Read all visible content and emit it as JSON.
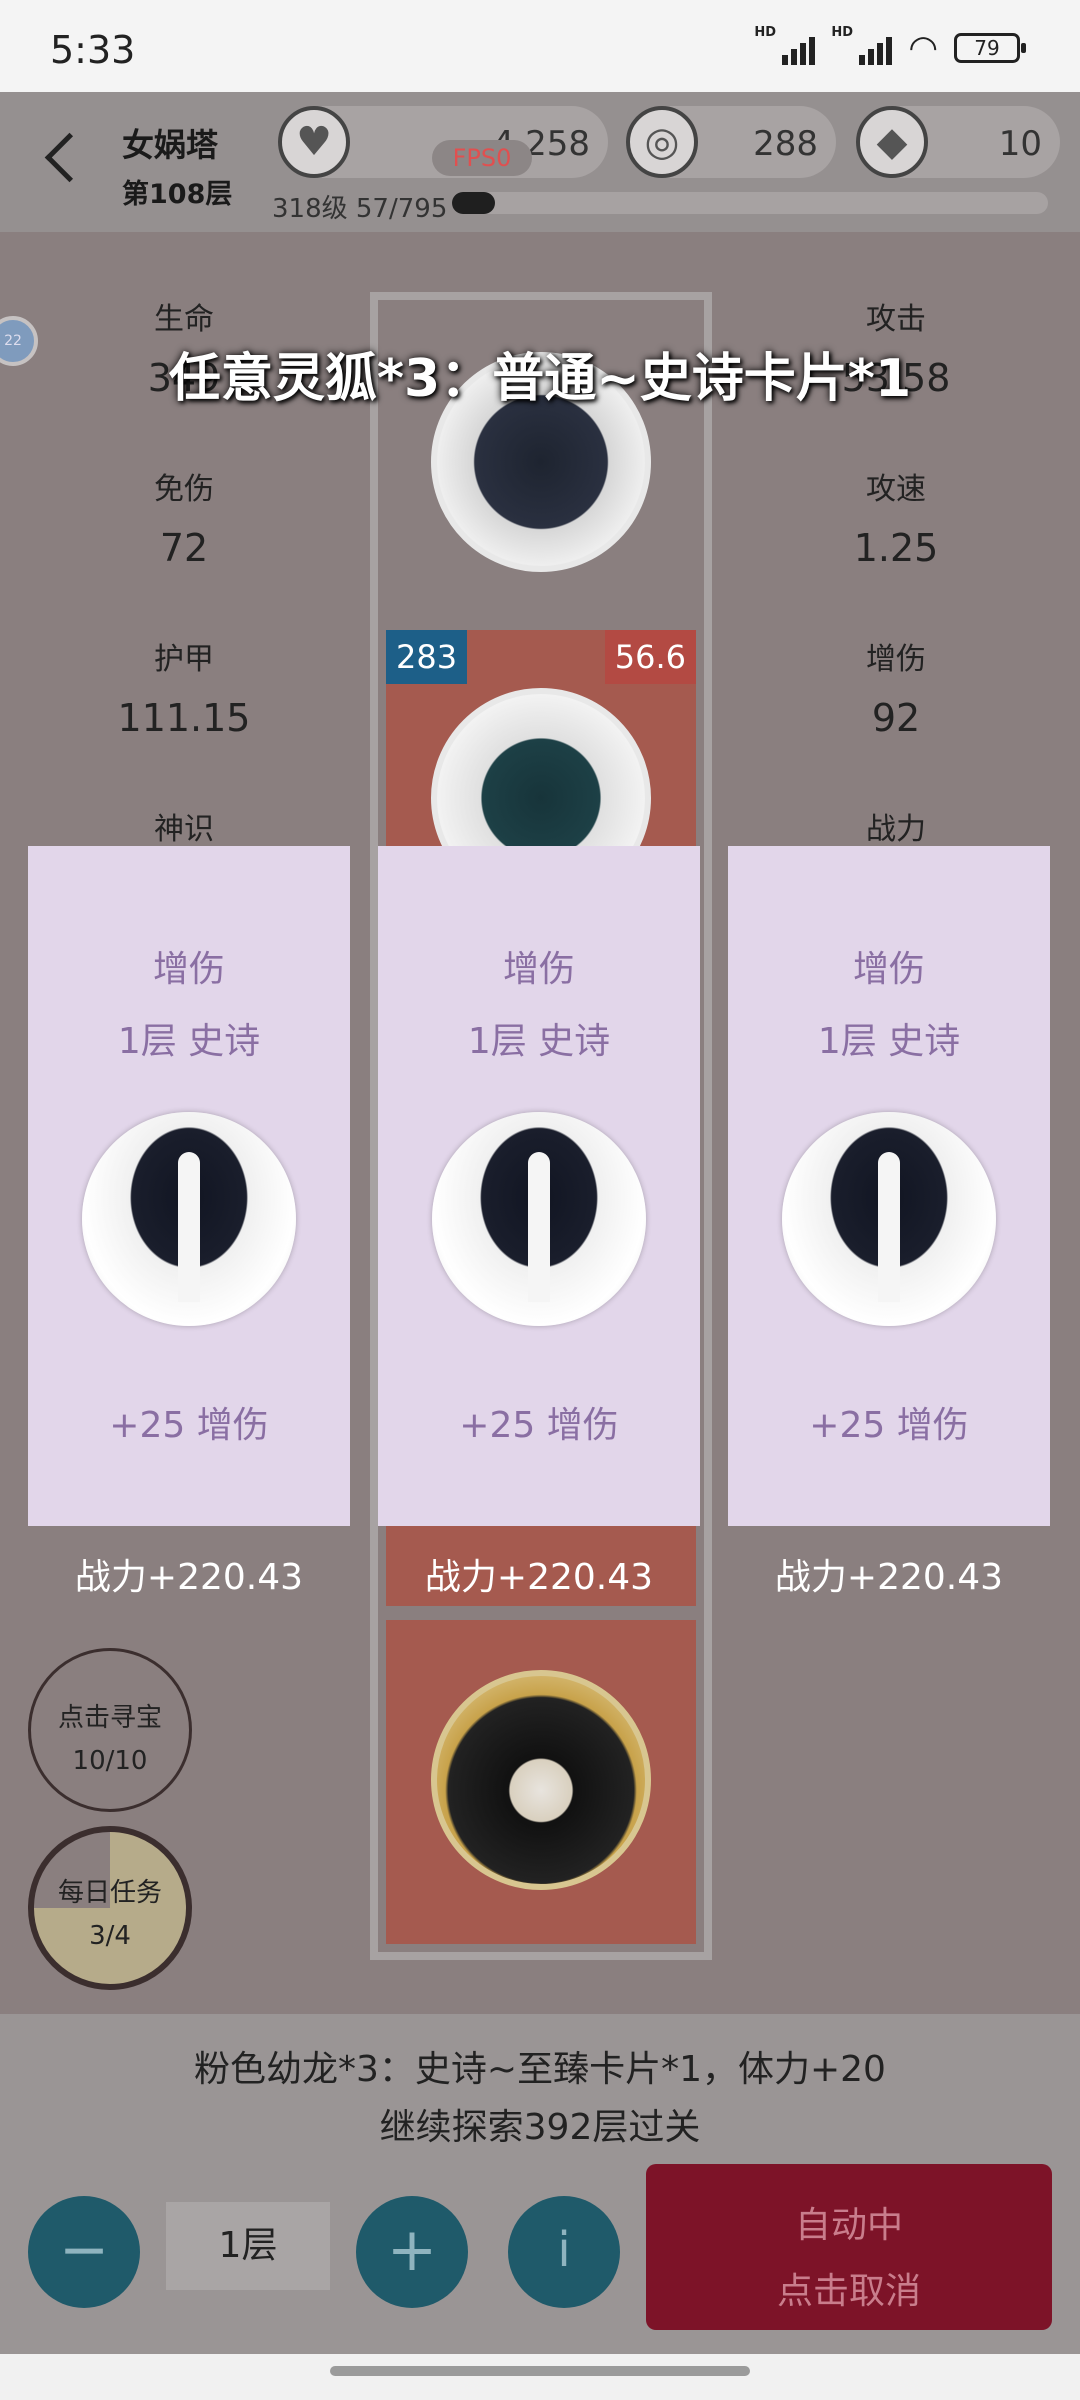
{
  "status_bar": {
    "time": "5:33",
    "hd1": "HD",
    "hd2": "HD",
    "battery": "79"
  },
  "header": {
    "tower_name": "女娲塔",
    "floor": "第108层",
    "resources": [
      {
        "icon": "heart-icon",
        "value": "4,258"
      },
      {
        "icon": "coin-icon",
        "value": "288"
      },
      {
        "icon": "diamond-icon",
        "value": "10"
      }
    ],
    "fps": "FPS0",
    "level_text": "318级 57/795",
    "xp_progress": 0.0717
  },
  "side_badge": "22",
  "banner": "任意灵狐*3：普通~史诗卡片*1",
  "stats_left": [
    {
      "label": "生命",
      "value": "349"
    },
    {
      "label": "免伤",
      "value": "72"
    },
    {
      "label": "护甲",
      "value": "111.15"
    },
    {
      "label": "神识",
      "value": ""
    }
  ],
  "stats_right": [
    {
      "label": "攻击",
      "value": "53.58"
    },
    {
      "label": "攻速",
      "value": "1.25"
    },
    {
      "label": "增伤",
      "value": "92"
    },
    {
      "label": "战力",
      "value": ""
    }
  ],
  "column": {
    "badge_left": "283",
    "badge_right": "56.6"
  },
  "cards": [
    {
      "attr": "增伤",
      "tier": "1层 史诗",
      "bonus": "+25 增伤",
      "power": "战力+220.43"
    },
    {
      "attr": "增伤",
      "tier": "1层 史诗",
      "bonus": "+25 增伤",
      "power": "战力+220.43"
    },
    {
      "attr": "增伤",
      "tier": "1层 史诗",
      "bonus": "+25 增伤",
      "power": "战力+220.43"
    }
  ],
  "treasure": {
    "label": "点击寻宝",
    "count": "10/10"
  },
  "daily": {
    "label": "每日任务",
    "count": "3/4",
    "progress": 0.75
  },
  "bottom": {
    "message1": "粉色幼龙*3：史诗~至臻卡片*1，体力+20",
    "message2": "继续探索392层过关",
    "minus": "−",
    "floor_value": "1层",
    "plus": "+",
    "info": "i",
    "auto_line1": "自动中",
    "auto_line2": "点击取消"
  },
  "colors": {
    "accent_purple": "#8a6fa3",
    "card_bg": "#e2d6ea",
    "auto_button": "#7d1328",
    "circle_button": "#1f5a6a",
    "tile_red": "#a55a4f",
    "badge_blue": "#1d5f88",
    "badge_red": "#b34a43"
  }
}
